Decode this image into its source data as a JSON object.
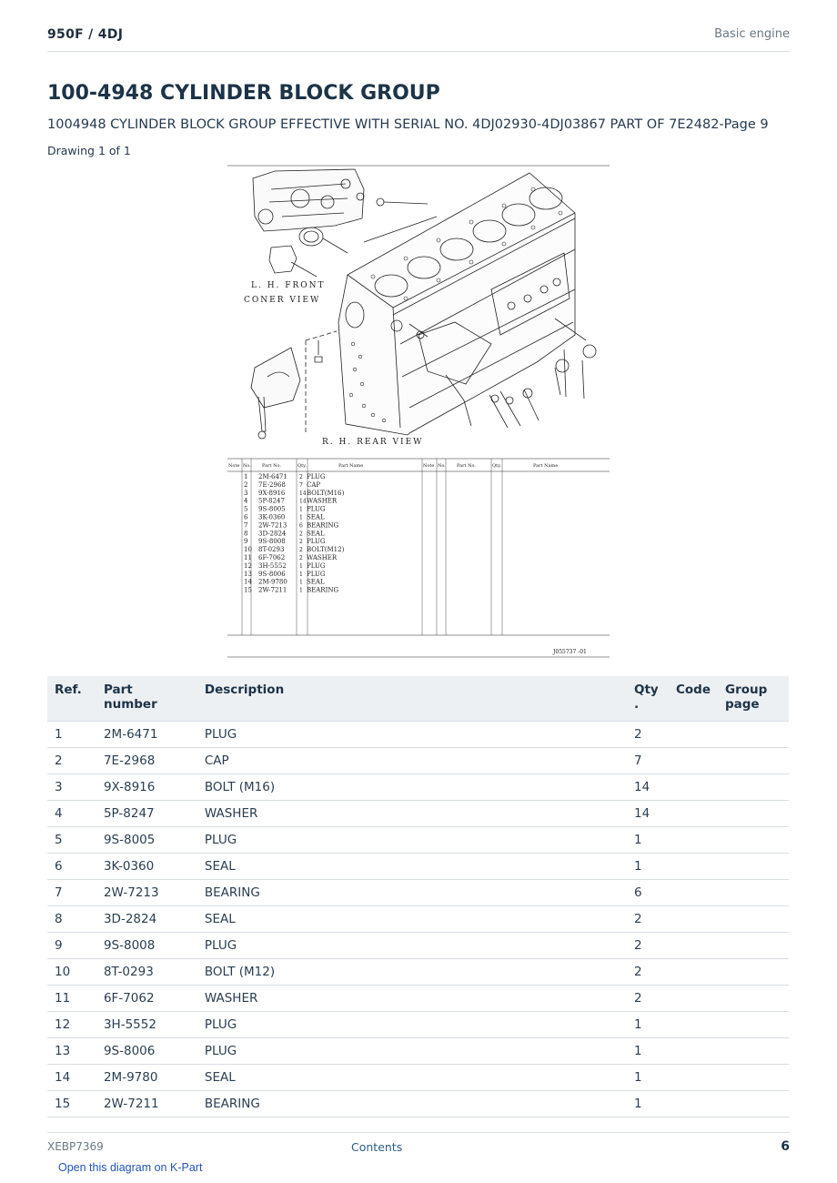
{
  "header": {
    "model": "950F  /  4DJ",
    "section": "Basic engine"
  },
  "title": "100-4948 CYLINDER BLOCK GROUP",
  "subtitle": "1004948 CYLINDER BLOCK GROUP EFFECTIVE WITH SERIAL NO. 4DJ02930-4DJ03867 PART OF 7E2482-Page 9",
  "drawing_label": "Drawing 1 of 1",
  "drawing": {
    "view_labels": [
      "L. H. FRONT",
      "CONER  VIEW",
      "R. H. REAR  VIEW"
    ],
    "table_headers": [
      "Note",
      "No.",
      "Part No.",
      "Qty.",
      "Part Name"
    ],
    "drawing_number": "J055737  -01"
  },
  "table": {
    "headers": {
      "ref": "Ref.",
      "part": "Part number",
      "desc": "Description",
      "qty": "Qty",
      "qty_dot": ".",
      "code": "Code",
      "group1": "Group",
      "group2": "page"
    },
    "rows": [
      {
        "ref": "1",
        "part": "2M-6471",
        "desc": "PLUG",
        "qty": "2",
        "code": "",
        "group": "",
        "inset_name": "PLUG"
      },
      {
        "ref": "2",
        "part": "7E-2968",
        "desc": "CAP",
        "qty": "7",
        "code": "",
        "group": "",
        "inset_name": "CAP"
      },
      {
        "ref": "3",
        "part": "9X-8916",
        "desc": "BOLT (M16)",
        "qty": "14",
        "code": "",
        "group": "",
        "inset_name": "BOLT(M16)"
      },
      {
        "ref": "4",
        "part": "5P-8247",
        "desc": "WASHER",
        "qty": "14",
        "code": "",
        "group": "",
        "inset_name": "WASHER"
      },
      {
        "ref": "5",
        "part": "9S-8005",
        "desc": "PLUG",
        "qty": "1",
        "code": "",
        "group": "",
        "inset_name": "PLUG"
      },
      {
        "ref": "6",
        "part": "3K-0360",
        "desc": "SEAL",
        "qty": "1",
        "code": "",
        "group": "",
        "inset_name": "SEAL"
      },
      {
        "ref": "7",
        "part": "2W-7213",
        "desc": "BEARING",
        "qty": "6",
        "code": "",
        "group": "",
        "inset_name": "BEARING"
      },
      {
        "ref": "8",
        "part": "3D-2824",
        "desc": "SEAL",
        "qty": "2",
        "code": "",
        "group": "",
        "inset_name": "SEAL"
      },
      {
        "ref": "9",
        "part": "9S-8008",
        "desc": "PLUG",
        "qty": "2",
        "code": "",
        "group": "",
        "inset_name": "PLUG"
      },
      {
        "ref": "10",
        "part": "8T-0293",
        "desc": "BOLT (M12)",
        "qty": "2",
        "code": "",
        "group": "",
        "inset_name": "BOLT(M12)"
      },
      {
        "ref": "11",
        "part": "6F-7062",
        "desc": "WASHER",
        "qty": "2",
        "code": "",
        "group": "",
        "inset_name": "WASHER"
      },
      {
        "ref": "12",
        "part": "3H-5552",
        "desc": "PLUG",
        "qty": "1",
        "code": "",
        "group": "",
        "inset_name": "PLUG"
      },
      {
        "ref": "13",
        "part": "9S-8006",
        "desc": "PLUG",
        "qty": "1",
        "code": "",
        "group": "",
        "inset_name": "PLUG"
      },
      {
        "ref": "14",
        "part": "2M-9780",
        "desc": "SEAL",
        "qty": "1",
        "code": "",
        "group": "",
        "inset_name": "SEAL"
      },
      {
        "ref": "15",
        "part": "2W-7211",
        "desc": "BEARING",
        "qty": "1",
        "code": "",
        "group": "",
        "inset_name": "BEARING"
      }
    ]
  },
  "footer": {
    "doc_id": "XEBP7369",
    "contents": "Contents",
    "page": "6",
    "kpart_link": "Open this diagram on K-Part"
  }
}
